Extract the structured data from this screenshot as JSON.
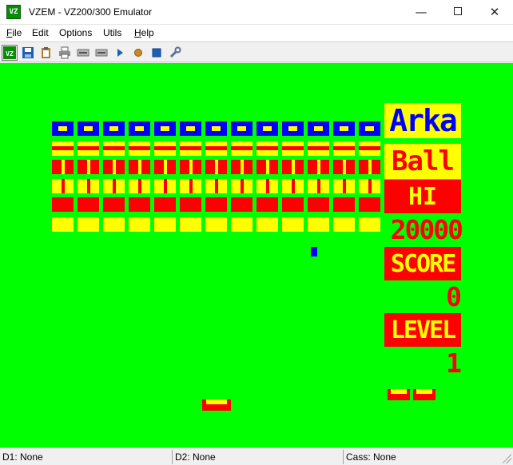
{
  "window": {
    "title": "VZEM - VZ200/300 Emulator",
    "icon_text": "VZ",
    "minimize_glyph": "—",
    "close_glyph": "✕"
  },
  "menu": [
    {
      "label": "File",
      "accel": "F",
      "rest": "ile"
    },
    {
      "label": "Edit",
      "accel": "",
      "rest": "Edit"
    },
    {
      "label": "Options",
      "accel": "",
      "rest": "Options"
    },
    {
      "label": "Utils",
      "accel": "",
      "rest": "Utils"
    },
    {
      "label": "Help",
      "accel": "H",
      "rest": "elp"
    }
  ],
  "toolbar": [
    {
      "name": "vz-logo-icon",
      "color": "#0b8a0b"
    },
    {
      "name": "save-icon",
      "color": "#1e5fb4"
    },
    {
      "name": "clipboard-icon",
      "color": "#b08030"
    },
    {
      "name": "printer-icon",
      "color": "#606060"
    },
    {
      "name": "disk-drive-1-icon",
      "color": "#808080"
    },
    {
      "name": "disk-drive-2-icon",
      "color": "#808080"
    },
    {
      "name": "play-icon",
      "color": "#1e5fb4"
    },
    {
      "name": "record-icon",
      "color": "#c88a1e"
    },
    {
      "name": "stop-icon",
      "color": "#1e5fb4"
    },
    {
      "name": "wrench-icon",
      "color": "#5a6e96"
    }
  ],
  "game": {
    "colors": {
      "background": "#00ff00",
      "yellow": "#ffff00",
      "red": "#ff0000",
      "blue": "#0000ff"
    },
    "brick_columns": 13,
    "brick_rows": [
      {
        "style": "blue-frame"
      },
      {
        "style": "yellow-red-stripe"
      },
      {
        "style": "red-yellow-bar"
      },
      {
        "style": "yellow-red-bar"
      },
      {
        "style": "red-solid"
      },
      {
        "style": "yellow-solid"
      }
    ],
    "hud": {
      "title_line1": "Arka",
      "title_line2": "Ball",
      "hi_label": "HI",
      "hi_value": "20000",
      "score_label": "SCORE",
      "score_value": "0",
      "level_label": "LEVEL",
      "level_value": "1"
    },
    "lives_remaining": 2
  },
  "status": {
    "d1": "D1: None",
    "d2": "D2: None",
    "cass": "Cass: None"
  }
}
